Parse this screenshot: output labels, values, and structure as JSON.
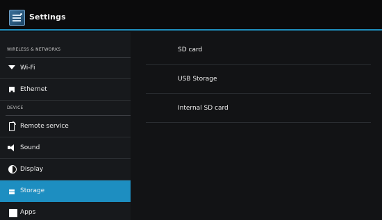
{
  "header": {
    "title": "Settings",
    "icon": "settings-app-icon"
  },
  "sidebar": {
    "sections": [
      {
        "title": "WIRELESS & NETWORKS",
        "items": [
          {
            "label": "Wi-Fi",
            "icon": "wifi-icon"
          },
          {
            "label": "Ethernet",
            "icon": "ethernet-icon"
          }
        ]
      },
      {
        "title": "DEVICE",
        "items": [
          {
            "label": "Remote service",
            "icon": "remote-service-icon"
          },
          {
            "label": "Sound",
            "icon": "sound-icon"
          },
          {
            "label": "Display",
            "icon": "display-icon"
          },
          {
            "label": "Storage",
            "icon": "storage-icon",
            "selected": true
          },
          {
            "label": "Apps",
            "icon": "apps-icon"
          }
        ]
      }
    ]
  },
  "main": {
    "items": [
      {
        "label": "SD card"
      },
      {
        "label": "USB Storage"
      },
      {
        "label": "Internal SD card"
      }
    ]
  },
  "colors": {
    "accent": "#1d8ec1",
    "background": "#111214",
    "sidebar": "#17191c",
    "action_bar": "#0b0b0c"
  }
}
